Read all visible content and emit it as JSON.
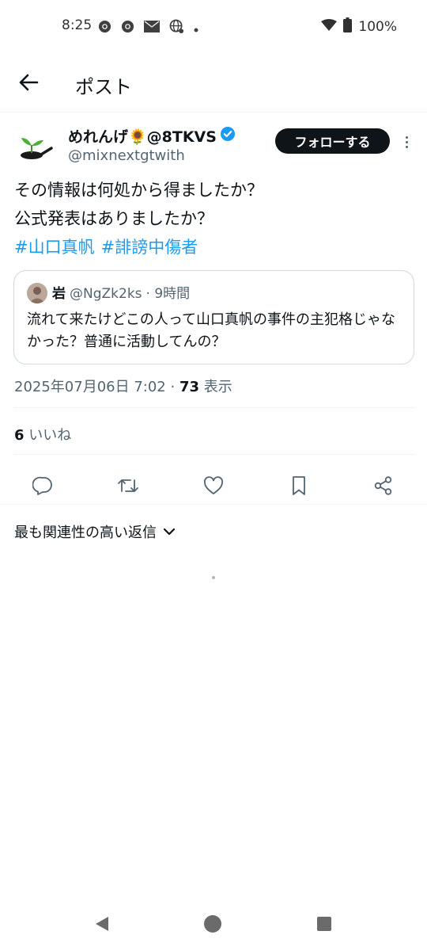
{
  "status_bar": {
    "time": "8:25",
    "battery": "100%",
    "icons_left": [
      "chrome-icon",
      "chrome-icon",
      "email-icon",
      "globe-icon",
      "dot-icon"
    ],
    "icons_right": [
      "wifi-icon",
      "battery-icon"
    ]
  },
  "header": {
    "title": "ポスト",
    "back_icon": "arrow-left-icon"
  },
  "post": {
    "author_name": "めれんげ🌻@8TKVS",
    "author_handle": "@mixnextgtwith",
    "verified": true,
    "follow_label": "フォローする",
    "text_line1": "その情報は何処から得ましたか？",
    "text_line2": "公式発表はありましたか？",
    "hashtags": [
      "#山口真帆",
      "#誹謗中傷者"
    ],
    "quote": {
      "name": "岩",
      "handle": "@NgZk2ks",
      "time": "· 9時間",
      "text": "流れて来たけどこの人って山口真帆の事件の主犯格じゃなかった？普通に活動してんの？"
    },
    "timestamp": "2025年07月06日 7:02 · ",
    "views_count": "73",
    "views_label": " 表示",
    "likes_count": "6",
    "likes_label": " いいね"
  },
  "actions": [
    "reply-icon",
    "retweet-icon",
    "like-icon",
    "bookmark-icon",
    "share-icon"
  ],
  "replies": {
    "sort_label": "最も関連性の高い返信"
  },
  "colors": {
    "accent": "#1d9bf0",
    "text": "#0f1419",
    "secondary": "#536471",
    "border": "#eff3f4"
  }
}
